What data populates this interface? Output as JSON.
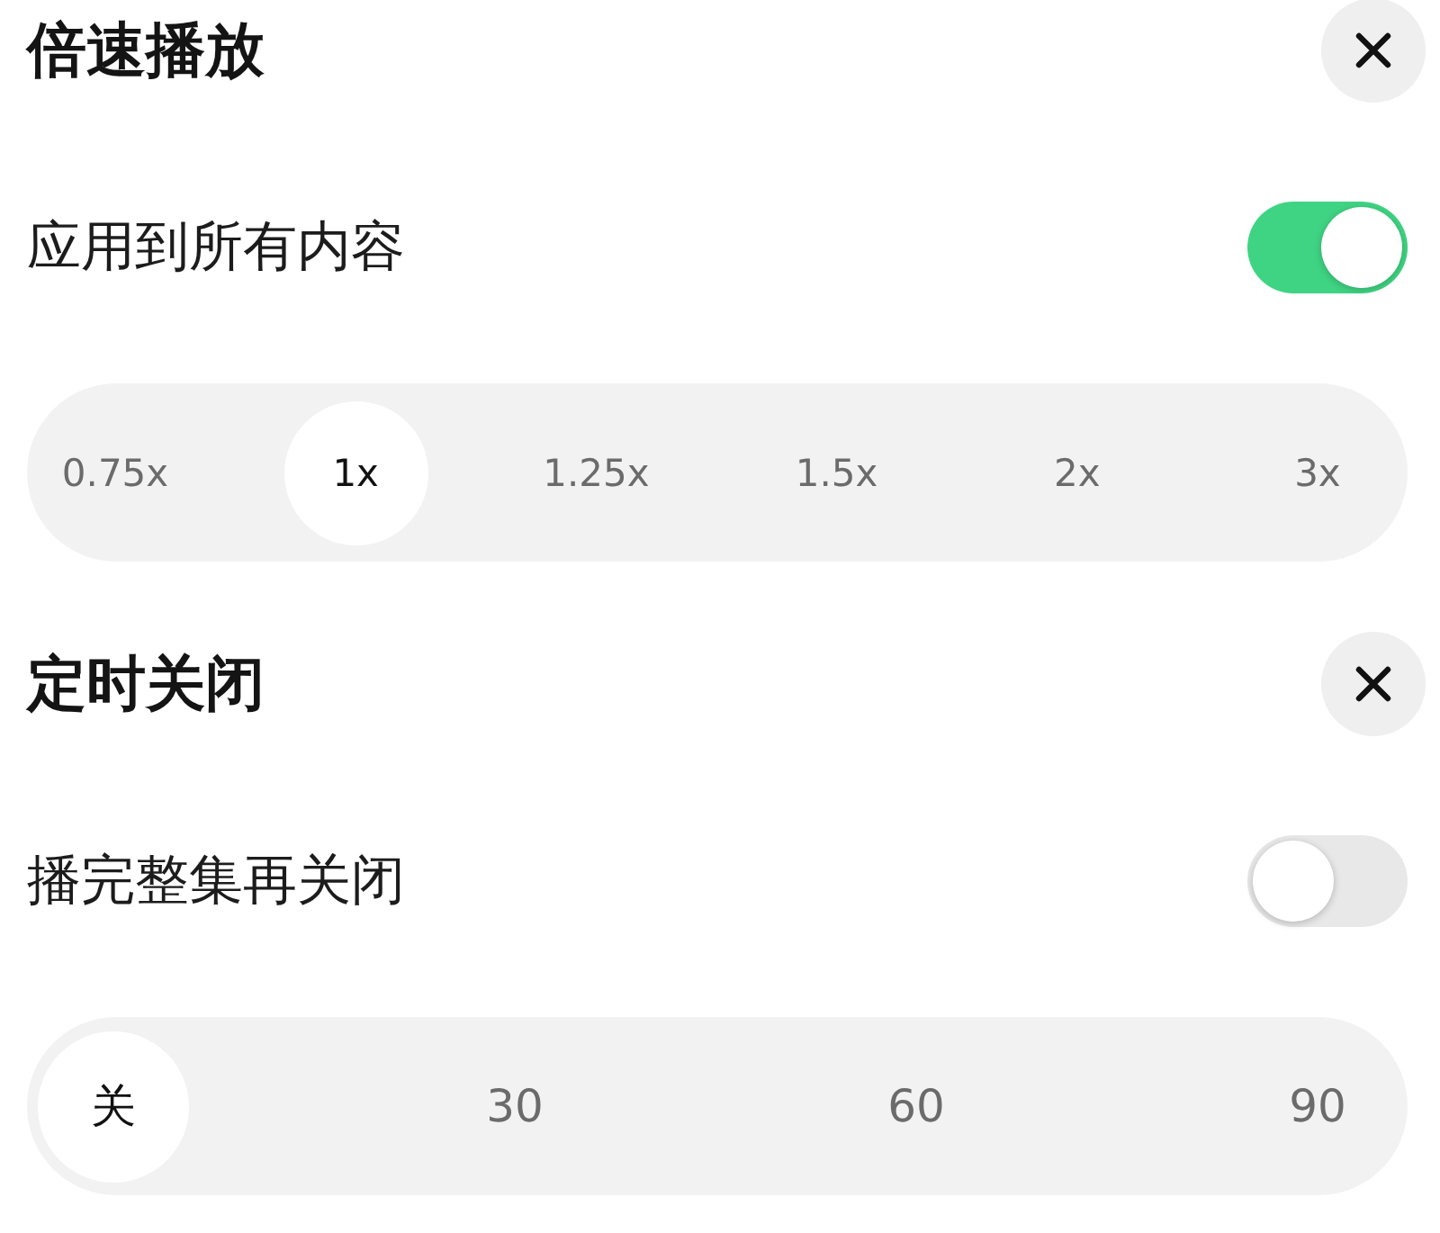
{
  "sections": [
    {
      "title": "倍速播放",
      "option": {
        "label": "应用到所有内容",
        "on": true
      },
      "choices": [
        {
          "label": "0.75x",
          "selected": false
        },
        {
          "label": "1x",
          "selected": true
        },
        {
          "label": "1.25x",
          "selected": false
        },
        {
          "label": "1.5x",
          "selected": false
        },
        {
          "label": "2x",
          "selected": false
        },
        {
          "label": "3x",
          "selected": false
        }
      ]
    },
    {
      "title": "定时关闭",
      "option": {
        "label": "播完整集再关闭",
        "on": false
      },
      "choices": [
        {
          "label": "关",
          "selected": true
        },
        {
          "label": "30",
          "selected": false
        },
        {
          "label": "60",
          "selected": false
        },
        {
          "label": "90",
          "selected": false
        }
      ]
    }
  ]
}
